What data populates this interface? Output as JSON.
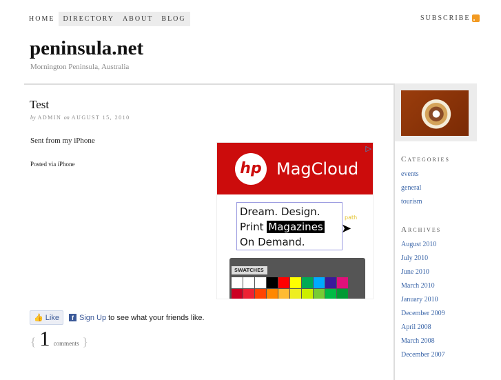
{
  "nav": {
    "items": [
      "HOME",
      "DIRECTORY",
      "ABOUT",
      "BLOG"
    ],
    "subscribe": "SUBSCRIBE"
  },
  "site": {
    "title": "peninsula.net",
    "tagline": "Mornington Peninsula, Australia"
  },
  "post": {
    "title": "Test",
    "by": "by",
    "author": "ADMIN",
    "on": "on",
    "date": "AUGUST 15, 2010",
    "body": "Sent from my iPhone",
    "footer": "Posted via iPhone"
  },
  "ad": {
    "brand": "hp",
    "product": "MagCloud",
    "line1": "Dream. Design.",
    "line2a": "Print",
    "line2b": "Magazines",
    "line3": "On Demand.",
    "path": "path",
    "panel": "SWATCHES"
  },
  "facebook": {
    "like": "Like",
    "signup": "Sign Up",
    "text": "to see what your friends like."
  },
  "comments": {
    "open": "{",
    "count": "1",
    "label": "comments",
    "close": "}"
  },
  "sidebar": {
    "categories_title": "Categories",
    "categories": [
      "events",
      "general",
      "tourism"
    ],
    "archives_title": "Archives",
    "archives": [
      "August 2010",
      "July 2010",
      "June 2010",
      "March 2010",
      "January 2010",
      "December 2009",
      "April 2008",
      "March 2008",
      "December 2007"
    ]
  }
}
